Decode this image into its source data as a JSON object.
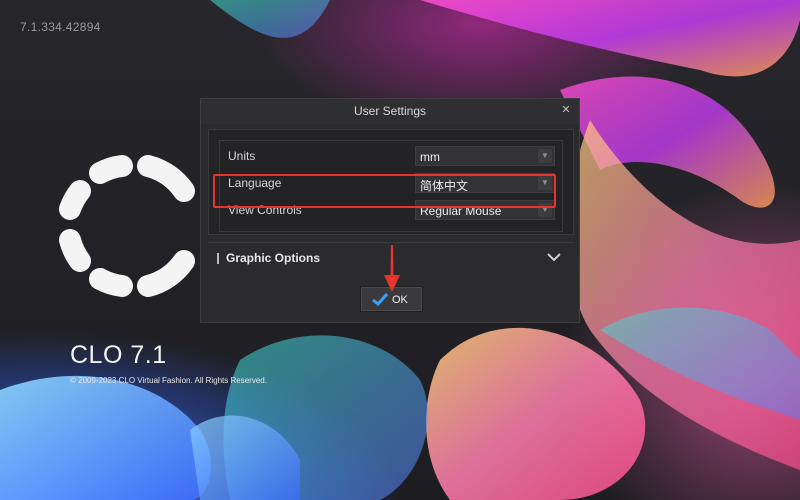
{
  "splash": {
    "version": "7.1.334.42894",
    "brand": "CLO 7.1",
    "copyright": "© 2009-2023 CLO Virtual Fashion. All Rights Reserved.",
    "logo_icon": "clo-segmented-ring-logo",
    "background_icon": "betta-fish-artwork"
  },
  "dialog": {
    "title": "User Settings",
    "close_glyph": "✕",
    "rows": [
      {
        "label": "Units",
        "value": "mm"
      },
      {
        "label": "Language",
        "value": "简体中文"
      },
      {
        "label": "View Controls",
        "value": "Regular Mouse"
      }
    ],
    "dropdown_glyph": "▼",
    "graphic_options_label": "Graphic Options",
    "ok_label": "OK"
  },
  "colors": {
    "highlight": "#e5352c",
    "ok_check": "#3aa0ff",
    "panel_bg": "#2b2b2d"
  }
}
